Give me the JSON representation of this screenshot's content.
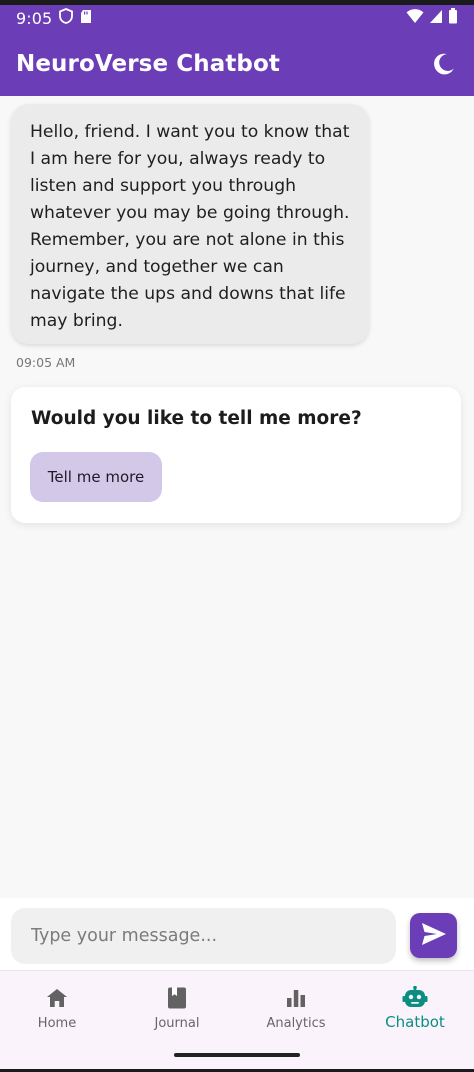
{
  "status_bar": {
    "time": "9:05"
  },
  "app_bar": {
    "title": "NeuroVerse Chatbot",
    "theme_icon": "moon-icon"
  },
  "chat": {
    "bot_message": "Hello, friend. I want you to know that I am here for you, always ready to listen and support you through whatever you may be going through. Remember, you are not alone in this journey, and together we can navigate the ups and downs that life may bring.",
    "timestamp": "09:05 AM",
    "suggestion_card": {
      "title": "Would you like to tell me more?",
      "button_label": "Tell me more"
    }
  },
  "composer": {
    "placeholder": "Type your message...",
    "send_icon": "send-icon"
  },
  "bottom_nav": {
    "items": [
      {
        "label": "Home",
        "icon": "home-icon",
        "active": false
      },
      {
        "label": "Journal",
        "icon": "book-icon",
        "active": false
      },
      {
        "label": "Analytics",
        "icon": "bar-chart-icon",
        "active": false
      },
      {
        "label": "Chatbot",
        "icon": "robot-icon",
        "active": true
      }
    ]
  },
  "colors": {
    "primary": "#6b3db6",
    "accent": "#0b8e82",
    "button_tonal": "#d3c8e8"
  }
}
